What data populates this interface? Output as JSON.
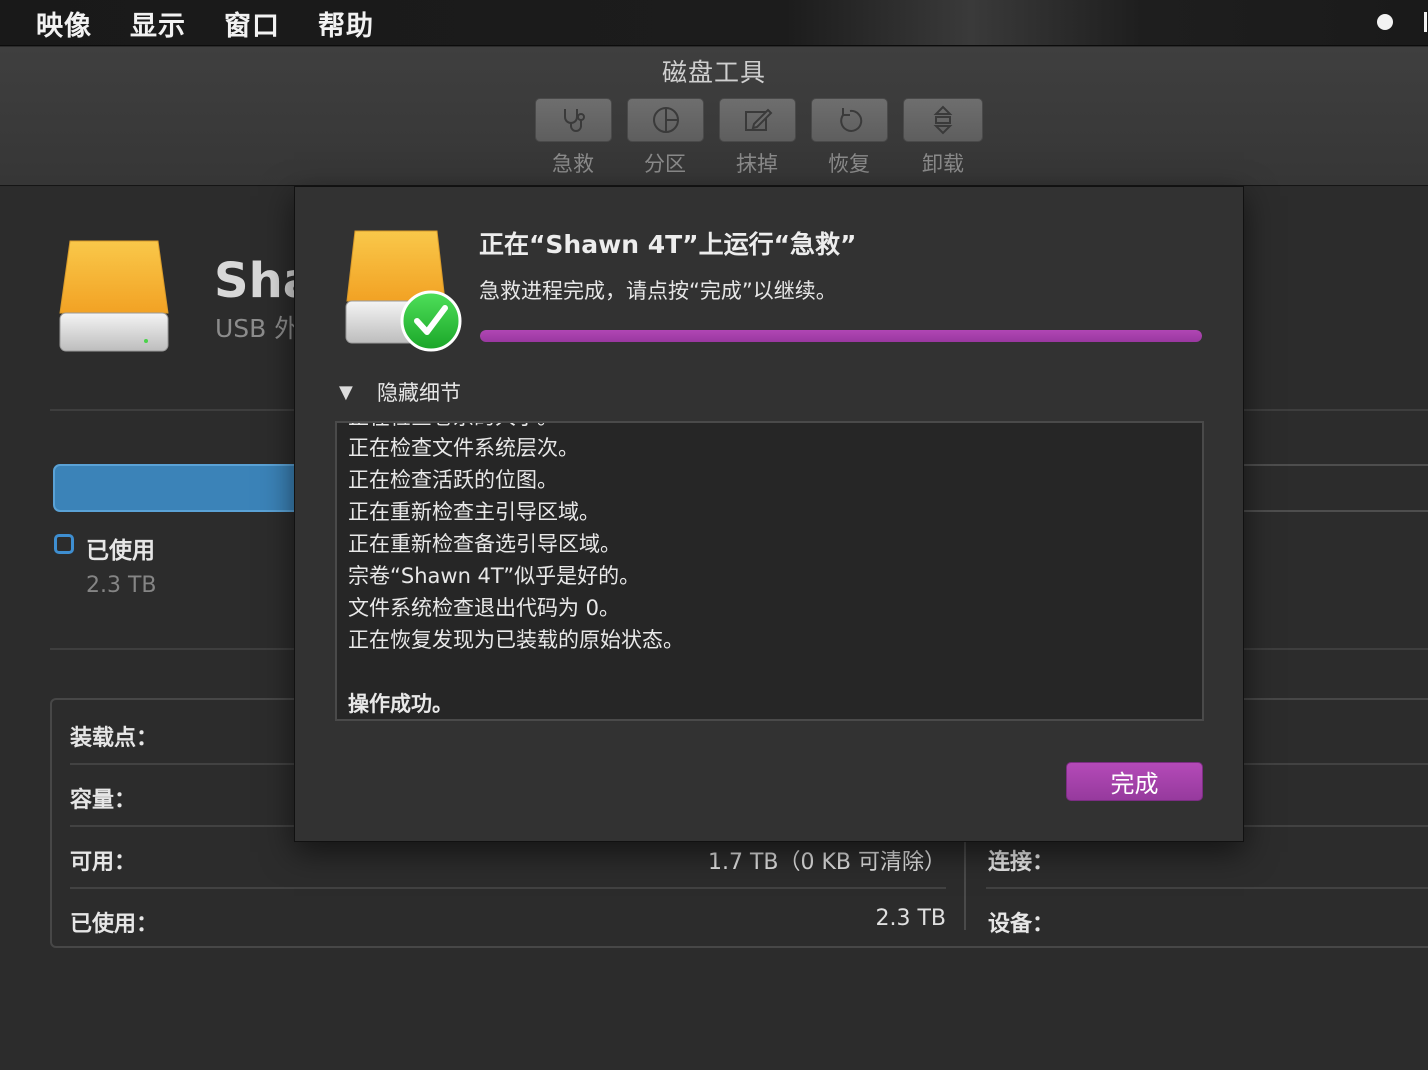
{
  "menubar": {
    "items": [
      "映像",
      "显示",
      "窗口",
      "帮助"
    ]
  },
  "window": {
    "title": "磁盘工具"
  },
  "toolbar": {
    "buttons": [
      {
        "label": "急救",
        "icon": "stethoscope-icon"
      },
      {
        "label": "分区",
        "icon": "pie-partition-icon"
      },
      {
        "label": "抹掉",
        "icon": "erase-pencil-icon"
      },
      {
        "label": "恢复",
        "icon": "restore-arrow-icon"
      },
      {
        "label": "卸载",
        "icon": "unmount-icon"
      }
    ]
  },
  "disk": {
    "name_visible": "Sha",
    "subtitle_visible": "USB 外",
    "icon": "external-drive-icon"
  },
  "usage": {
    "legend_label": "已使用",
    "legend_value": "2.3 TB",
    "accent_color": "#3b83b8"
  },
  "info": {
    "rows": [
      {
        "label": "装载点：",
        "value": ""
      },
      {
        "label": "容量：",
        "value": ""
      },
      {
        "label": "可用：",
        "value": "1.7 TB（0 KB 可清除）"
      },
      {
        "label": "已使用：",
        "value": "2.3 TB"
      }
    ],
    "right_rows": [
      {
        "label": "连接："
      },
      {
        "label": "设备："
      }
    ]
  },
  "dialog": {
    "title": "正在“Shawn 4T”上运行“急救”",
    "message": "急救进程完成，请点按“完成”以继续。",
    "progress_fraction": 1.0,
    "progress_color": "#a83fae",
    "details_toggle": "隐藏细节",
    "log_lines": [
      "正在检查文件系统层次。",
      "正在检查活跃的位图。",
      "正在重新检查主引导区域。",
      "正在重新检查备选引导区域。",
      "宗卷“Shawn 4T”似乎是好的。",
      "文件系统检查退出代码为 0。",
      "正在恢复发现为已装载的原始状态。",
      "",
      "操作成功。"
    ],
    "done_button": "完成",
    "badge_icon": "checkmark-badge-icon"
  }
}
